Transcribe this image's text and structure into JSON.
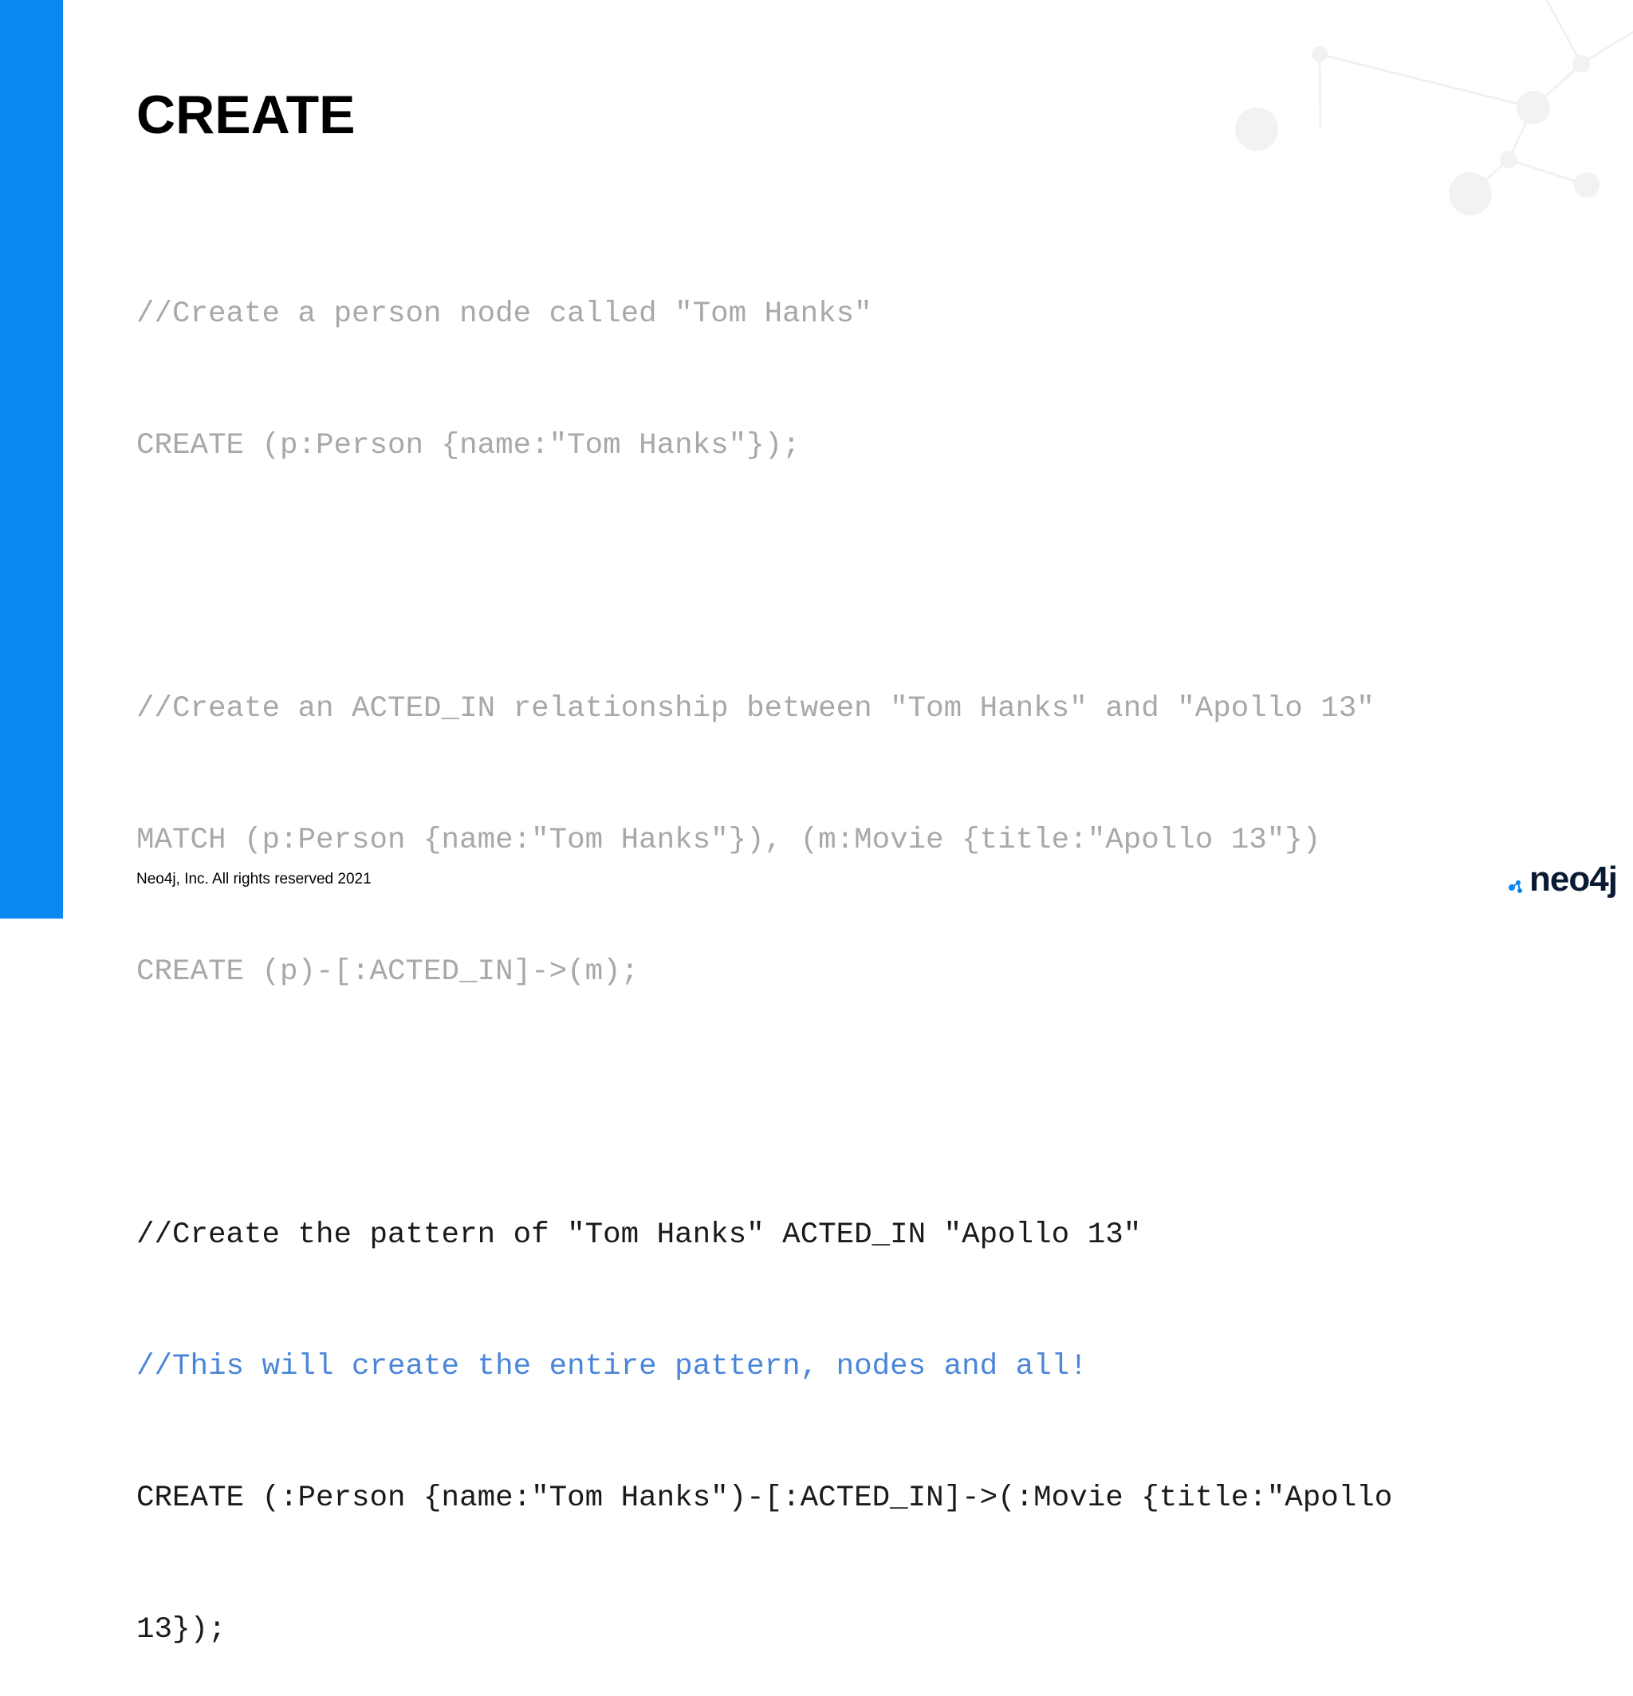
{
  "slide": {
    "title": "CREATE",
    "footer": "Neo4j, Inc. All rights reserved 2021",
    "logo_text": "neo4j"
  },
  "colors": {
    "accent_bar": "#0a87f2",
    "faded_code": "#a8a8a8",
    "active_code": "#1a1a1a",
    "comment_blue": "#4a86d8"
  },
  "code": {
    "block1": {
      "comment": "//Create a person node called \"Tom Hanks\"",
      "statement": "CREATE (p:Person {name:\"Tom Hanks\"});"
    },
    "block2": {
      "comment": "//Create an ACTED_IN relationship between \"Tom Hanks\" and \"Apollo 13\"",
      "match": "MATCH (p:Person {name:\"Tom Hanks\"}), (m:Movie {title:\"Apollo 13\"})",
      "statement": "CREATE (p)-[:ACTED_IN]->(m);"
    },
    "block3": {
      "comment": "//Create the pattern of \"Tom Hanks\" ACTED_IN \"Apollo 13\"",
      "note": "//This will create the entire pattern, nodes and all!",
      "statement_line1": "CREATE (:Person {name:\"Tom Hanks\")-[:ACTED_IN]->(:Movie {title:\"Apollo",
      "statement_line2": "13});"
    }
  }
}
